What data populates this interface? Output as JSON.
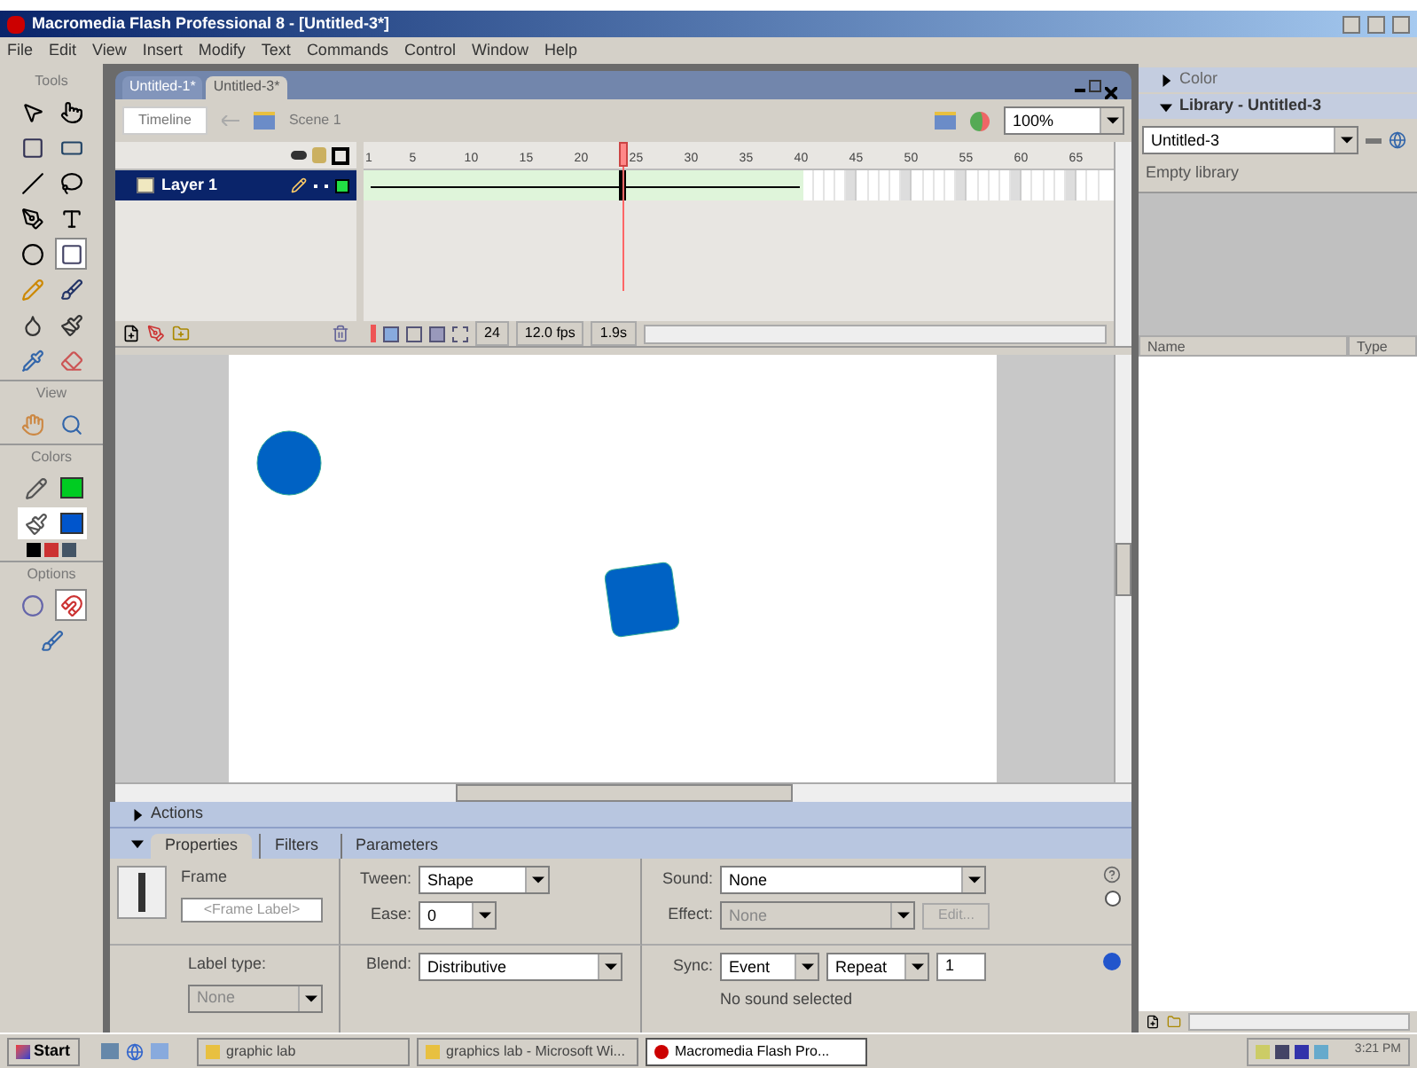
{
  "window": {
    "title": "Macromedia Flash Professional 8 - [Untitled-3*]"
  },
  "menu": [
    "File",
    "Edit",
    "View",
    "Insert",
    "Modify",
    "Text",
    "Commands",
    "Control",
    "Window",
    "Help"
  ],
  "tools": {
    "title": "Tools",
    "view_title": "View",
    "colors_title": "Colors",
    "options_title": "Options"
  },
  "document_tabs": [
    {
      "label": "Untitled-1*",
      "selected": false
    },
    {
      "label": "Untitled-3*",
      "selected": true
    }
  ],
  "edit_bar": {
    "timeline_button": "Timeline",
    "scene": "Scene 1",
    "zoom": "100%"
  },
  "timeline": {
    "ruler": [
      "1",
      "5",
      "10",
      "15",
      "20",
      "25",
      "30",
      "35",
      "40",
      "45",
      "50",
      "55",
      "60",
      "65"
    ],
    "layers": [
      {
        "name": "Layer 1",
        "selected": true
      }
    ],
    "current_frame": "24",
    "frame_rate": "12.0 fps",
    "elapsed": "1.9s"
  },
  "panels": {
    "actions": {
      "title": "Actions",
      "expanded": false
    },
    "property_tabs": [
      {
        "label": "Properties",
        "selected": true
      },
      {
        "label": "Filters",
        "selected": false
      },
      {
        "label": "Parameters",
        "selected": false
      }
    ]
  },
  "properties": {
    "frame_label": "Frame",
    "frame_placeholder": "<Frame Label>",
    "label_type_label": "Label type:",
    "label_type": "None",
    "tween_label": "Tween:",
    "tween": "Shape",
    "ease_label": "Ease:",
    "ease": "0",
    "blend_label": "Blend:",
    "blend": "Distributive",
    "sound_label": "Sound:",
    "sound": "None",
    "effect_label": "Effect:",
    "effect": "None",
    "edit_button": "Edit...",
    "sync_label": "Sync:",
    "sync": "Event",
    "repeat": "Repeat",
    "repeat_count": "1",
    "sound_status": "No sound selected"
  },
  "right_panels": {
    "color": {
      "title": "Color",
      "expanded": false
    },
    "library": {
      "title": "Library - Untitled-3",
      "expanded": true,
      "document": "Untitled-3",
      "status": "Empty library",
      "columns": [
        "Name",
        "Type"
      ]
    }
  },
  "taskbar": {
    "start": "Start",
    "tasks": [
      {
        "label": "graphic lab",
        "selected": false
      },
      {
        "label": "graphics lab - Microsoft Wi...",
        "selected": false
      },
      {
        "label": "Macromedia Flash Pro...",
        "selected": true
      }
    ],
    "clock": "3:21 PM"
  }
}
